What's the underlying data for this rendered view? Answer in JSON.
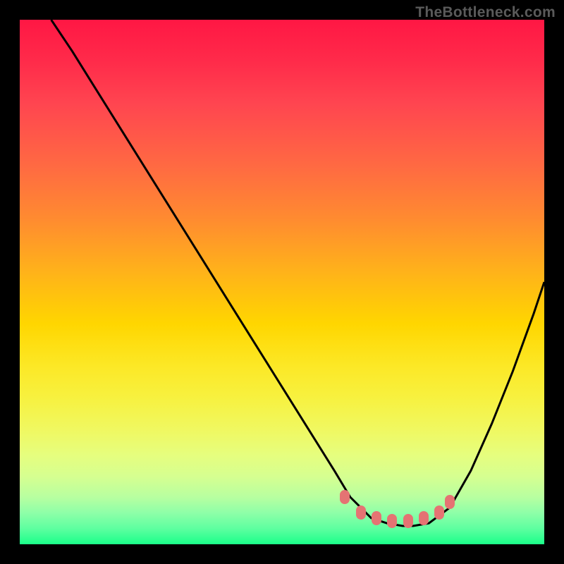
{
  "watermark": "TheBottleneck.com",
  "chart_data": {
    "type": "line",
    "title": "",
    "xlabel": "",
    "ylabel": "",
    "xlim": [
      0,
      100
    ],
    "ylim": [
      0,
      100
    ],
    "grid": false,
    "legend": false,
    "axes_visible": false,
    "background_gradient": {
      "direction": "vertical",
      "top_color": "#ff1744",
      "mid_color": "#ffd600",
      "bottom_color": "#1aff8a"
    },
    "series": [
      {
        "name": "bottleneck-curve",
        "color": "#000000",
        "x": [
          6,
          10,
          15,
          20,
          25,
          30,
          35,
          40,
          45,
          50,
          55,
          60,
          63,
          67,
          70,
          73,
          75,
          78,
          82,
          86,
          90,
          94,
          98,
          100
        ],
        "y": [
          100,
          94,
          86,
          78,
          70,
          62,
          54,
          46,
          38,
          30,
          22,
          14,
          9,
          5,
          4,
          3.5,
          3.5,
          4,
          7,
          14,
          23,
          33,
          44,
          50
        ]
      }
    ],
    "markers": {
      "name": "optimal-range",
      "color": "#e57373",
      "shape": "capsule",
      "points": [
        {
          "x": 62,
          "y": 9
        },
        {
          "x": 65,
          "y": 6
        },
        {
          "x": 68,
          "y": 5
        },
        {
          "x": 71,
          "y": 4.5
        },
        {
          "x": 74,
          "y": 4.5
        },
        {
          "x": 77,
          "y": 5
        },
        {
          "x": 80,
          "y": 6
        },
        {
          "x": 82,
          "y": 8
        }
      ]
    }
  }
}
